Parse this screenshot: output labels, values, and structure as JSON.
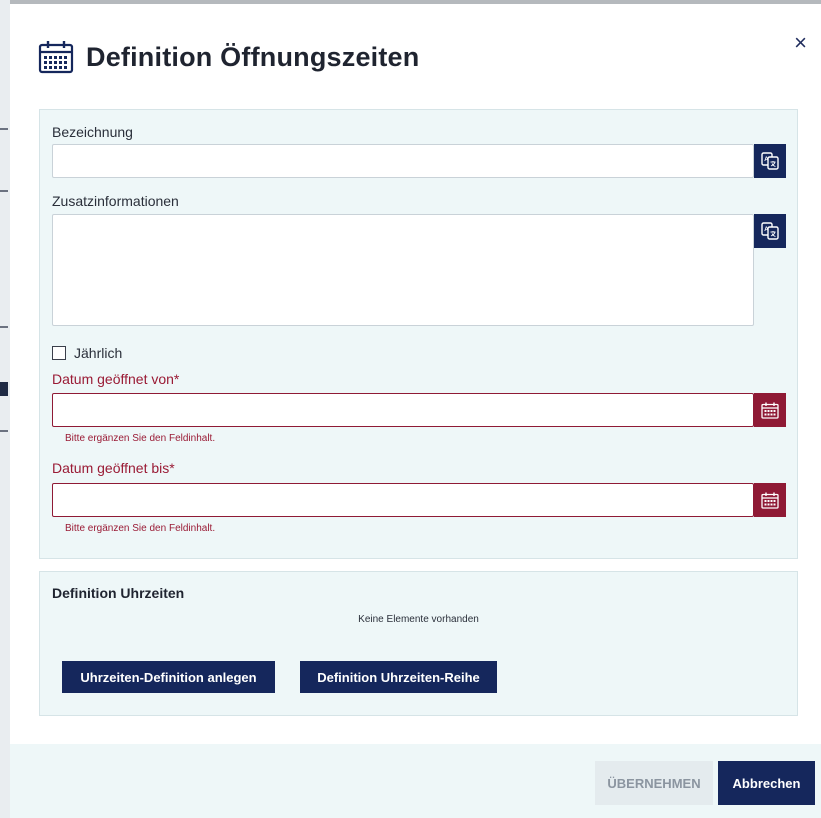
{
  "dialog": {
    "title": "Definition Öffnungszeiten",
    "title_icon": "calendar-icon",
    "close_label": "×"
  },
  "form": {
    "bezeichnung": {
      "label": "Bezeichnung",
      "value": "",
      "translate_icon": "translate-icon"
    },
    "zusatzinformationen": {
      "label": "Zusatzinformationen",
      "value": "",
      "translate_icon": "translate-icon"
    },
    "jaehrlich": {
      "label": "Jährlich",
      "checked": false
    },
    "datum_von": {
      "label": "Datum geöffnet von*",
      "value": "",
      "hint": "Bitte ergänzen Sie den Feldinhalt.",
      "picker_icon": "calendar-icon"
    },
    "datum_bis": {
      "label": "Datum geöffnet bis*",
      "value": "",
      "hint": "Bitte ergänzen Sie den Feldinhalt.",
      "picker_icon": "calendar-icon"
    }
  },
  "uhrzeiten": {
    "title": "Definition Uhrzeiten",
    "empty_text": "Keine Elemente vorhanden",
    "create_label": "Uhrzeiten-Definition anlegen",
    "series_label": "Definition Uhrzeiten-Reihe"
  },
  "footer": {
    "apply_label": "ÜBERNEHMEN",
    "cancel_label": "Abbrechen"
  },
  "colors": {
    "navy": "#15275c",
    "error": "#8f1a35",
    "panel": "#eef7f8"
  }
}
